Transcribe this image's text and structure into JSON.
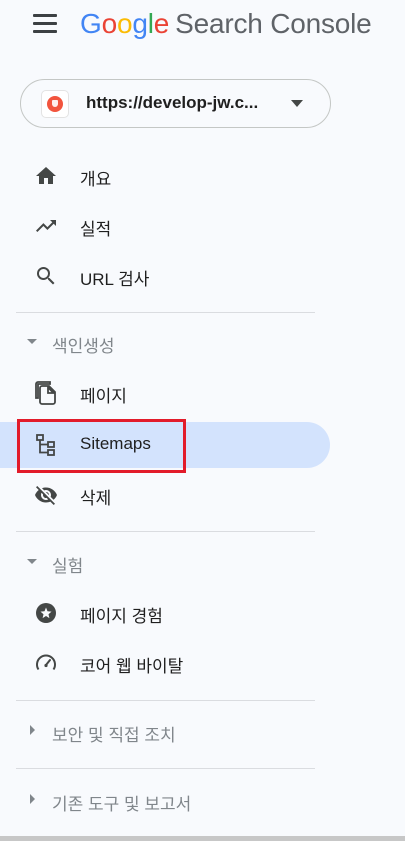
{
  "header": {
    "logo_letters": [
      "G",
      "o",
      "o",
      "g",
      "l",
      "e"
    ],
    "product_name": "Search Console",
    "menu_icon": "hamburger-menu-icon"
  },
  "property_selector": {
    "label": "https://develop-jw.c...",
    "favicon_color": "#f2543d",
    "caret_icon": "dropdown-caret-icon"
  },
  "nav": {
    "overview": {
      "label": "개요",
      "icon": "home-icon"
    },
    "performance": {
      "label": "실적",
      "icon": "trending-up-icon"
    },
    "url_inspection": {
      "label": "URL 검사",
      "icon": "search-icon"
    },
    "indexing_section": {
      "label": "색인생성",
      "expanded": true
    },
    "pages": {
      "label": "페이지",
      "icon": "file-copy-icon"
    },
    "sitemaps": {
      "label": "Sitemaps",
      "icon": "sitemap-icon",
      "active": true
    },
    "removals": {
      "label": "삭제",
      "icon": "visibility-off-icon"
    },
    "experience_section": {
      "label": "실험",
      "expanded": true
    },
    "page_experience": {
      "label": "페이지 경험",
      "icon": "star-badge-icon"
    },
    "core_web_vitals": {
      "label": "코어 웹 바이탈",
      "icon": "speedometer-icon"
    },
    "security_section": {
      "label": "보안 및 직접 조치",
      "expanded": false
    },
    "legacy_section": {
      "label": "기존 도구 및 보고서",
      "expanded": false
    }
  },
  "colors": {
    "active_bg": "#d3e3fd",
    "highlight_border": "#e21b2a",
    "icon": "#444746",
    "section_text": "#80868b"
  }
}
